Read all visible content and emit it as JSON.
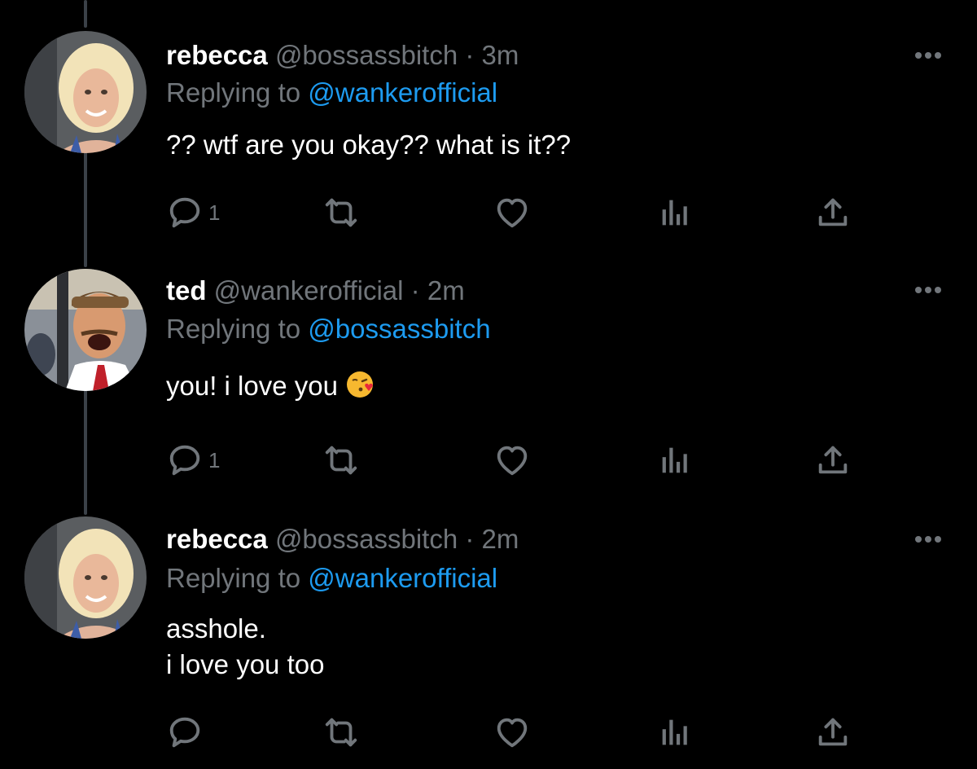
{
  "colors": {
    "background": "#000000",
    "text": "#ffffff",
    "muted": "#71767b",
    "link": "#1d9bf0",
    "thread_line": "#3b4148"
  },
  "replying_prefix": "Replying to",
  "tweets": [
    {
      "name": "rebecca",
      "handle": "@bossassbitch",
      "separator": "·",
      "time": "3m",
      "replying_to": "@wankerofficial",
      "lines": [
        "?? wtf are you okay?? what is it??"
      ],
      "reply_count": "1",
      "avatar": "blonde-woman-avatar"
    },
    {
      "name": "ted",
      "handle": "@wankerofficial",
      "separator": "·",
      "time": "2m",
      "replying_to": "@bossassbitch",
      "lines": [
        "you! i love you"
      ],
      "emoji": "face-blowing-kiss-emoji",
      "reply_count": "1",
      "avatar": "man-selfie-avatar"
    },
    {
      "name": "rebecca",
      "handle": "@bossassbitch",
      "separator": "·",
      "time": "2m",
      "replying_to": "@wankerofficial",
      "lines": [
        "asshole.",
        "i love you too"
      ],
      "reply_count": "",
      "avatar": "blonde-woman-avatar"
    }
  ],
  "icons": [
    "reply-icon",
    "retweet-icon",
    "like-icon",
    "analytics-icon",
    "share-icon",
    "more-options-icon"
  ]
}
